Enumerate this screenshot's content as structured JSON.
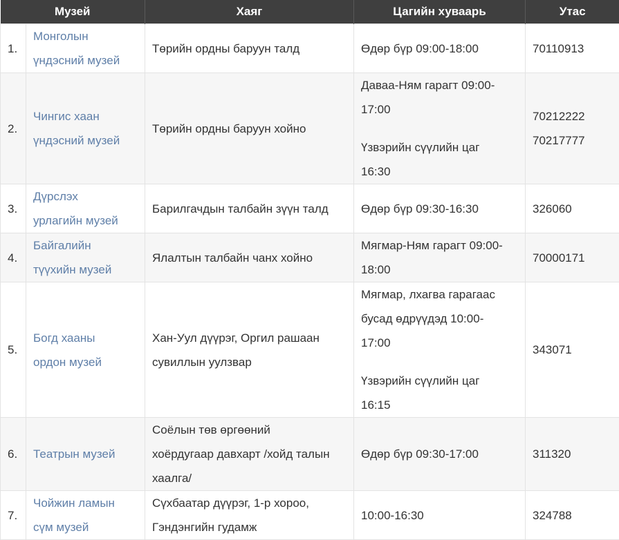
{
  "headers": [
    "Музей",
    "Хаяг",
    "Цагийн хуваарь",
    "Утас"
  ],
  "rows": [
    {
      "num": "1.",
      "name": [
        "Монголын",
        "үндэсний музей"
      ],
      "address": [
        "Төрийн ордны баруун талд"
      ],
      "schedule": [
        [
          "Өдөр бүр 09:00-18:00"
        ]
      ],
      "phone": [
        "70110913"
      ]
    },
    {
      "num": "2.",
      "name": [
        "Чингис хаан",
        "үндэсний музей"
      ],
      "address": [
        "Төрийн ордны баруун хойно"
      ],
      "schedule": [
        [
          "Даваа-Ням гарагт 09:00-",
          "17:00"
        ],
        [
          "Үзвэрийн сүүлийн цаг",
          "16:30"
        ]
      ],
      "phone": [
        "70212222",
        "70217777"
      ]
    },
    {
      "num": "3.",
      "name": [
        "Дүрслэх",
        "урлагийн музей"
      ],
      "address": [
        "Барилгачдын талбайн зүүн талд"
      ],
      "schedule": [
        [
          "Өдөр бүр 09:30-16:30"
        ]
      ],
      "phone": [
        "326060"
      ]
    },
    {
      "num": "4.",
      "name": [
        "Байгалийн",
        "түүхийн музей"
      ],
      "address": [
        "Ялалтын талбайн чанх хойно"
      ],
      "schedule": [
        [
          "Мягмар-Ням гарагт 09:00-",
          "18:00"
        ]
      ],
      "phone": [
        "70000171"
      ]
    },
    {
      "num": "5.",
      "name": [
        "Богд хааны",
        "ордон музей"
      ],
      "address": [
        "Хан-Уул дүүрэг, Оргил рашаан",
        "сувиллын уулзвар"
      ],
      "schedule": [
        [
          "Мягмар, лхагва гарагаас",
          "бусад өдрүүдэд 10:00-",
          "17:00"
        ],
        [
          "Үзвэрийн сүүлийн цаг",
          "16:15"
        ]
      ],
      "phone": [
        "343071"
      ]
    },
    {
      "num": "6.",
      "name": [
        "Театрын музей"
      ],
      "address": [
        "Соёлын төв өргөөний",
        "хоёрдугаар давхарт /хойд талын",
        "хаалга/"
      ],
      "schedule": [
        [
          "Өдөр бүр 09:30-17:00"
        ]
      ],
      "phone": [
        "311320"
      ]
    },
    {
      "num": "7.",
      "name": [
        "Чойжин ламын",
        "сүм музей"
      ],
      "address": [
        "Сүхбаатар дүүрэг, 1-р хороо,",
        "Гэндэнгийн гудамж"
      ],
      "schedule": [
        [
          "10:00-16:30"
        ]
      ],
      "phone": [
        "324788"
      ]
    }
  ]
}
